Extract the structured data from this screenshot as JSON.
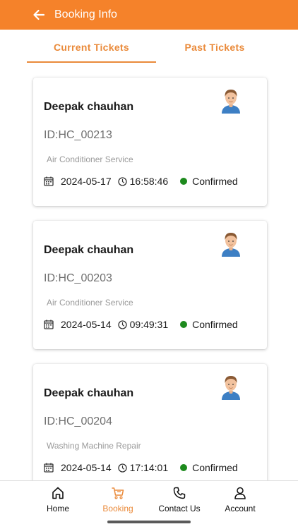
{
  "header": {
    "title": "Booking Info",
    "back_icon": "arrow-left-icon",
    "background": "#f5822a"
  },
  "tabs": [
    {
      "label": "Current Tickets",
      "active": true
    },
    {
      "label": "Past Tickets",
      "active": false
    }
  ],
  "accent_color": "#ea8a3a",
  "status_color": "#1d8a1d",
  "tickets": [
    {
      "name": "Deepak chauhan",
      "id": "ID:HC_00213",
      "service": "Air Conditioner Service",
      "date": "2024-05-17",
      "time": "16:58:46",
      "status": "Confirmed"
    },
    {
      "name": "Deepak chauhan",
      "id": "ID:HC_00203",
      "service": "Air Conditioner Service",
      "date": "2024-05-14",
      "time": "09:49:31",
      "status": "Confirmed"
    },
    {
      "name": "Deepak chauhan",
      "id": "ID:HC_00204",
      "service": "Washing Machine Repair",
      "date": "2024-05-14",
      "time": "17:14:01",
      "status": "Confirmed"
    }
  ],
  "bottom_nav": [
    {
      "label": "Home",
      "icon": "home-icon",
      "active": false
    },
    {
      "label": "Booking",
      "icon": "cart-icon",
      "active": true
    },
    {
      "label": "Contact Us",
      "icon": "phone-icon",
      "active": false
    },
    {
      "label": "Account",
      "icon": "user-icon",
      "active": false
    }
  ]
}
